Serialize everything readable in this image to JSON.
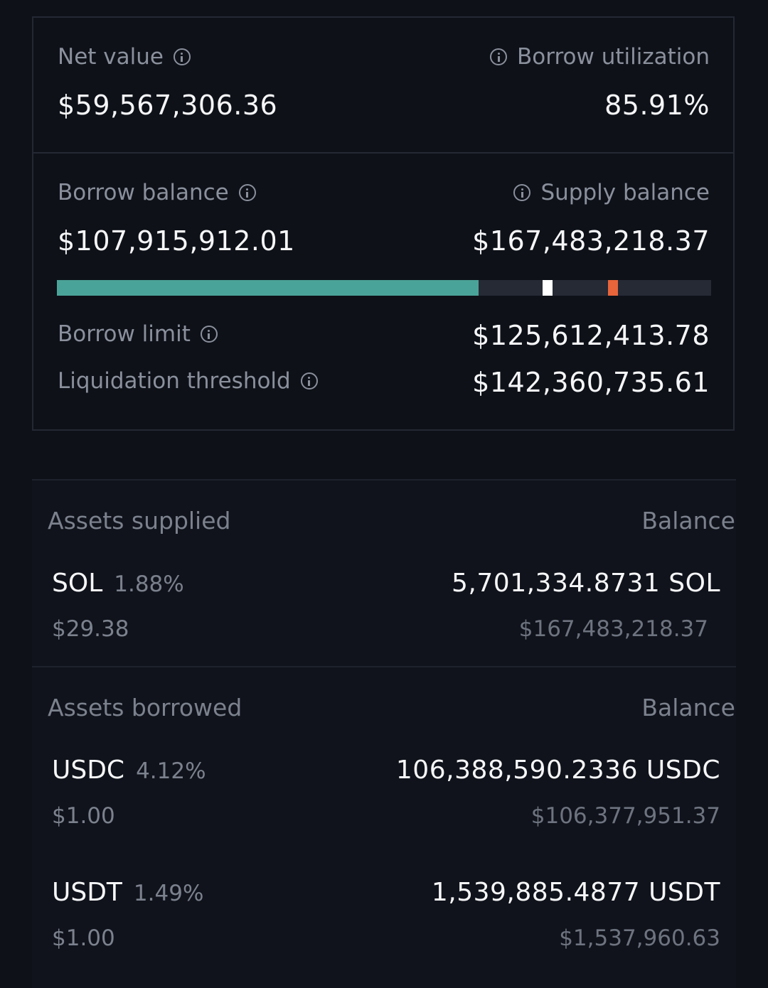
{
  "summary": {
    "net_value_label": "Net value",
    "net_value": "$59,567,306.36",
    "borrow_utilization_label": "Borrow utilization",
    "borrow_utilization": "85.91%"
  },
  "balances": {
    "borrow_balance_label": "Borrow balance",
    "borrow_balance": "$107,915,912.01",
    "supply_balance_label": "Supply balance",
    "supply_balance": "$167,483,218.37",
    "bar": {
      "borrow_fraction": 0.6443,
      "borrow_limit_fraction": 0.75,
      "liquidation_fraction": 0.85,
      "colors": {
        "fill": "#4aa398",
        "track": "#252a35",
        "borrow_limit_marker": "#ffffff",
        "liquidation_marker": "#e8643a"
      }
    },
    "borrow_limit_label": "Borrow limit",
    "borrow_limit": "$125,612,413.78",
    "liquidation_threshold_label": "Liquidation threshold",
    "liquidation_threshold": "$142,360,735.61"
  },
  "assets_supplied": {
    "title": "Assets supplied",
    "balance_header": "Balance",
    "items": [
      {
        "symbol": "SOL",
        "rate": "1.88%",
        "price": "$29.38",
        "balance": "5,701,334.8731 SOL",
        "usd_value": "$167,483,218.37"
      }
    ]
  },
  "assets_borrowed": {
    "title": "Assets borrowed",
    "balance_header": "Balance",
    "items": [
      {
        "symbol": "USDC",
        "rate": "4.12%",
        "price": "$1.00",
        "balance": "106,388,590.2336 USDC",
        "usd_value": "$106,377,951.37"
      },
      {
        "symbol": "USDT",
        "rate": "1.49%",
        "price": "$1.00",
        "balance": "1,539,885.4877 USDT",
        "usd_value": "$1,537,960.63"
      }
    ]
  },
  "icons": {
    "info": "info-icon"
  }
}
